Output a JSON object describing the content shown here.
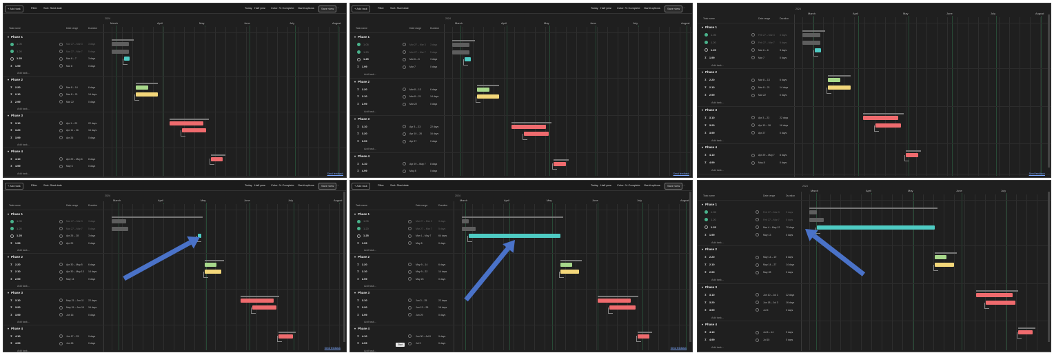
{
  "toolbar": {
    "add_task": "+ Add task",
    "filter": "Filter",
    "sort": "Sort: Start date",
    "today": "Today",
    "half_year": "Half year",
    "color": "Color: % Complete",
    "gantt_options": "Gantt options",
    "save_view": "Save view",
    "more": "···"
  },
  "year": "2024",
  "months": [
    "March",
    "April",
    "May",
    "June",
    "July",
    "August"
  ],
  "columns": {
    "task_name": "Task name",
    "date_range": "Date range",
    "duration": "Duration"
  },
  "add_task_row": "Add task...",
  "send_feedback": "Send feedback",
  "tooltip": "Start",
  "colors": {
    "teal": "#4ecbc3",
    "green": "#a8d88b",
    "yellow": "#f3d77a",
    "red": "#ef6b6e",
    "arrow": "#4a72c8"
  },
  "panels": [
    {
      "phases": [
        {
          "name": "Phase 1",
          "tasks": [
            {
              "id": "1.05",
              "status": "done",
              "range": "Mar 27 – Mar 3",
              "dur": "3 days"
            },
            {
              "id": "1.20",
              "status": "done",
              "range": "Mar 27 – Mar 7",
              "dur": "5 days"
            },
            {
              "id": "1.25",
              "status": "progress",
              "range": "Mar 6 – 7",
              "dur": "3 days"
            },
            {
              "id": "1.99",
              "status": "hourglass",
              "range": "Mar 8",
              "dur": "0 days"
            }
          ]
        },
        {
          "name": "Phase 2",
          "tasks": [
            {
              "id": "2.20",
              "status": "hourglass",
              "range": "Mar 8 – 14",
              "dur": "6 days"
            },
            {
              "id": "2.10",
              "status": "hourglass",
              "range": "Mar 8 – 21",
              "dur": "14 days"
            },
            {
              "id": "2.99",
              "status": "hourglass",
              "range": "Mar 22",
              "dur": "0 days"
            }
          ]
        },
        {
          "name": "Phase 3",
          "tasks": [
            {
              "id": "3.10",
              "status": "hourglass",
              "range": "Apr 1 – 23",
              "dur": "22 days"
            },
            {
              "id": "3.20",
              "status": "hourglass",
              "range": "Apr 11 – 26",
              "dur": "16 days"
            },
            {
              "id": "3.99",
              "status": "hourglass",
              "range": "Apr 26",
              "dur": "0 days"
            }
          ]
        },
        {
          "name": "Phase 4",
          "tasks": [
            {
              "id": "4.10",
              "status": "hourglass",
              "range": "Apr 29 – May 6",
              "dur": "8 days"
            },
            {
              "id": "4.99",
              "status": "hourglass",
              "range": "May 6",
              "dur": "0 days"
            }
          ]
        }
      ]
    },
    {
      "phases": [
        {
          "name": "Phase 1",
          "tasks": [
            {
              "id": "1.05",
              "status": "done",
              "range": "Mar 27 – Mar 3",
              "dur": "3 days"
            },
            {
              "id": "1.20",
              "status": "done",
              "range": "Mar 27 – Mar 7",
              "dur": "5 days"
            },
            {
              "id": "1.25",
              "status": "progress",
              "range": "Mar 6 – 6",
              "dur": "3 days"
            },
            {
              "id": "1.99",
              "status": "hourglass",
              "range": "Mar 7",
              "dur": "0 days"
            }
          ]
        },
        {
          "name": "Phase 2",
          "tasks": [
            {
              "id": "2.20",
              "status": "hourglass",
              "range": "Mar 8 – 13",
              "dur": "6 days"
            },
            {
              "id": "2.10",
              "status": "hourglass",
              "range": "Mar 8 – 21",
              "dur": "14 days"
            },
            {
              "id": "2.99",
              "status": "hourglass",
              "range": "Mar 22",
              "dur": "0 days"
            }
          ]
        },
        {
          "name": "Phase 3",
          "tasks": [
            {
              "id": "3.10",
              "status": "hourglass",
              "range": "Apr 3 – 23",
              "dur": "22 days"
            },
            {
              "id": "3.20",
              "status": "hourglass",
              "range": "Apr 10 – 26",
              "dur": "16 days"
            },
            {
              "id": "3.99",
              "status": "hourglass",
              "range": "Apr 27",
              "dur": "0 days"
            }
          ]
        },
        {
          "name": "Phase 4",
          "tasks": [
            {
              "id": "4.10",
              "status": "hourglass",
              "range": "Apr 29 – May 7",
              "dur": "8 days"
            },
            {
              "id": "4.99",
              "status": "hourglass",
              "range": "May 8",
              "dur": "0 days"
            }
          ]
        }
      ]
    },
    {
      "phases": [
        {
          "name": "Phase 1",
          "tasks": [
            {
              "id": "1.05",
              "status": "done",
              "range": "Feb 27 – Mar 3",
              "dur": "3 days"
            },
            {
              "id": "1.20",
              "status": "done",
              "range": "Feb 27 – Mar 7",
              "dur": "5 days"
            },
            {
              "id": "1.25",
              "status": "progress",
              "range": "Mar 6 – 6",
              "dur": "3 days"
            },
            {
              "id": "1.99",
              "status": "hourglass",
              "range": "Mar 7",
              "dur": "0 days"
            }
          ]
        },
        {
          "name": "Phase 2",
          "tasks": [
            {
              "id": "2.20",
              "status": "hourglass",
              "range": "Mar 8 – 13",
              "dur": "6 days"
            },
            {
              "id": "2.10",
              "status": "hourglass",
              "range": "Mar 8 – 21",
              "dur": "14 days"
            },
            {
              "id": "2.99",
              "status": "hourglass",
              "range": "Mar 22",
              "dur": "0 days"
            }
          ]
        },
        {
          "name": "Phase 3",
          "tasks": [
            {
              "id": "3.10",
              "status": "hourglass",
              "range": "Apr 3 – 23",
              "dur": "22 days"
            },
            {
              "id": "3.20",
              "status": "hourglass",
              "range": "Apr 10 – 26",
              "dur": "16 days"
            },
            {
              "id": "3.99",
              "status": "hourglass",
              "range": "Apr 27",
              "dur": "0 days"
            }
          ]
        },
        {
          "name": "Phase 4",
          "tasks": [
            {
              "id": "4.10",
              "status": "hourglass",
              "range": "Apr 29 – May 7",
              "dur": "8 days"
            },
            {
              "id": "4.99",
              "status": "hourglass",
              "range": "May 8",
              "dur": "0 days"
            }
          ]
        }
      ]
    },
    {
      "phases": [
        {
          "name": "Phase 1",
          "tasks": [
            {
              "id": "1.05",
              "status": "done",
              "range": "Mar 27 – Mar 3",
              "dur": "3 days"
            },
            {
              "id": "1.20",
              "status": "done",
              "range": "Mar 27 – Mar 7",
              "dur": "5 days"
            },
            {
              "id": "1.25",
              "status": "progress",
              "range": "Apr 26 – 28",
              "dur": "3 days"
            },
            {
              "id": "1.99",
              "status": "hourglass",
              "range": "Apr 29",
              "dur": "0 days"
            }
          ]
        },
        {
          "name": "Phase 2",
          "tasks": [
            {
              "id": "2.20",
              "status": "hourglass",
              "range": "Apr 30 – May 5",
              "dur": "6 days"
            },
            {
              "id": "2.10",
              "status": "hourglass",
              "range": "Apr 30 – May 13",
              "dur": "14 days"
            },
            {
              "id": "2.99",
              "status": "hourglass",
              "range": "May 14",
              "dur": "0 days"
            }
          ]
        },
        {
          "name": "Phase 3",
          "tasks": [
            {
              "id": "3.10",
              "status": "hourglass",
              "range": "May 21 – Jun 11",
              "dur": "22 days"
            },
            {
              "id": "3.20",
              "status": "hourglass",
              "range": "May 31 – Jun 15",
              "dur": "16 days"
            },
            {
              "id": "3.99",
              "status": "hourglass",
              "range": "Jun 16",
              "dur": "0 days"
            }
          ]
        },
        {
          "name": "Phase 4",
          "tasks": [
            {
              "id": "4.10",
              "status": "hourglass",
              "range": "Jun 17 – 25",
              "dur": "9 days"
            },
            {
              "id": "4.99",
              "status": "hourglass",
              "range": "Jun 26",
              "dur": "0 days"
            }
          ]
        }
      ]
    },
    {
      "phases": [
        {
          "name": "Phase 1",
          "tasks": [
            {
              "id": "1.05",
              "status": "done",
              "range": "Mar 27 – Mar 3",
              "dur": "3 days"
            },
            {
              "id": "1.20",
              "status": "done",
              "range": "Mar 27 – Mar 7",
              "dur": "5 days"
            },
            {
              "id": "1.25",
              "status": "progress",
              "range": "Mar 4 – May 7",
              "dur": "64 days"
            },
            {
              "id": "1.99",
              "status": "hourglass",
              "range": "May 8",
              "dur": "0 days"
            }
          ]
        },
        {
          "name": "Phase 2",
          "tasks": [
            {
              "id": "2.20",
              "status": "hourglass",
              "range": "May 9 – 14",
              "dur": "6 days"
            },
            {
              "id": "2.10",
              "status": "hourglass",
              "range": "May 9 – 22",
              "dur": "14 days"
            },
            {
              "id": "2.99",
              "status": "hourglass",
              "range": "May 23",
              "dur": "0 days"
            }
          ]
        },
        {
          "name": "Phase 3",
          "tasks": [
            {
              "id": "3.10",
              "status": "hourglass",
              "range": "Jun 3 – 25",
              "dur": "22 days"
            },
            {
              "id": "3.20",
              "status": "hourglass",
              "range": "Jun 13 – 28",
              "dur": "16 days"
            },
            {
              "id": "3.99",
              "status": "hourglass",
              "range": "Jun 29",
              "dur": "0 days"
            }
          ]
        },
        {
          "name": "Phase 4",
          "tasks": [
            {
              "id": "4.10",
              "status": "hourglass",
              "range": "Jun 30 – Jul 8",
              "dur": "9 days"
            },
            {
              "id": "4.99",
              "status": "hourglass",
              "range": "Jul 9",
              "dur": "0 days"
            }
          ]
        }
      ]
    },
    {
      "phases": [
        {
          "name": "Phase 1",
          "tasks": [
            {
              "id": "1.05",
              "status": "done",
              "range": "Feb 27 – Mar 3",
              "dur": "3 days"
            },
            {
              "id": "1.20",
              "status": "done",
              "range": "Feb 27 – Mar 7",
              "dur": "5 days"
            },
            {
              "id": "1.25",
              "status": "progress",
              "range": "Mar 4 – May 12",
              "dur": "70 days"
            },
            {
              "id": "1.99",
              "status": "hourglass",
              "range": "May 13",
              "dur": "0 days"
            }
          ]
        },
        {
          "name": "Phase 2",
          "tasks": [
            {
              "id": "2.20",
              "status": "hourglass",
              "range": "May 14 – 19",
              "dur": "6 days"
            },
            {
              "id": "2.10",
              "status": "hourglass",
              "range": "May 14 – 27",
              "dur": "14 days"
            },
            {
              "id": "2.99",
              "status": "hourglass",
              "range": "May 28",
              "dur": "0 days"
            }
          ]
        },
        {
          "name": "Phase 3",
          "tasks": [
            {
              "id": "3.10",
              "status": "hourglass",
              "range": "Jun 10 – Jul 1",
              "dur": "22 days"
            },
            {
              "id": "3.20",
              "status": "hourglass",
              "range": "Jun 18 – Jul 3",
              "dur": "16 days"
            },
            {
              "id": "3.99",
              "status": "hourglass",
              "range": "Jul 5",
              "dur": "0 days"
            }
          ]
        },
        {
          "name": "Phase 4",
          "tasks": [
            {
              "id": "4.10",
              "status": "hourglass",
              "range": "Jul 6 – 14",
              "dur": "9 days"
            },
            {
              "id": "4.99",
              "status": "hourglass",
              "range": "Jul 15",
              "dur": "0 days"
            }
          ]
        }
      ]
    }
  ]
}
